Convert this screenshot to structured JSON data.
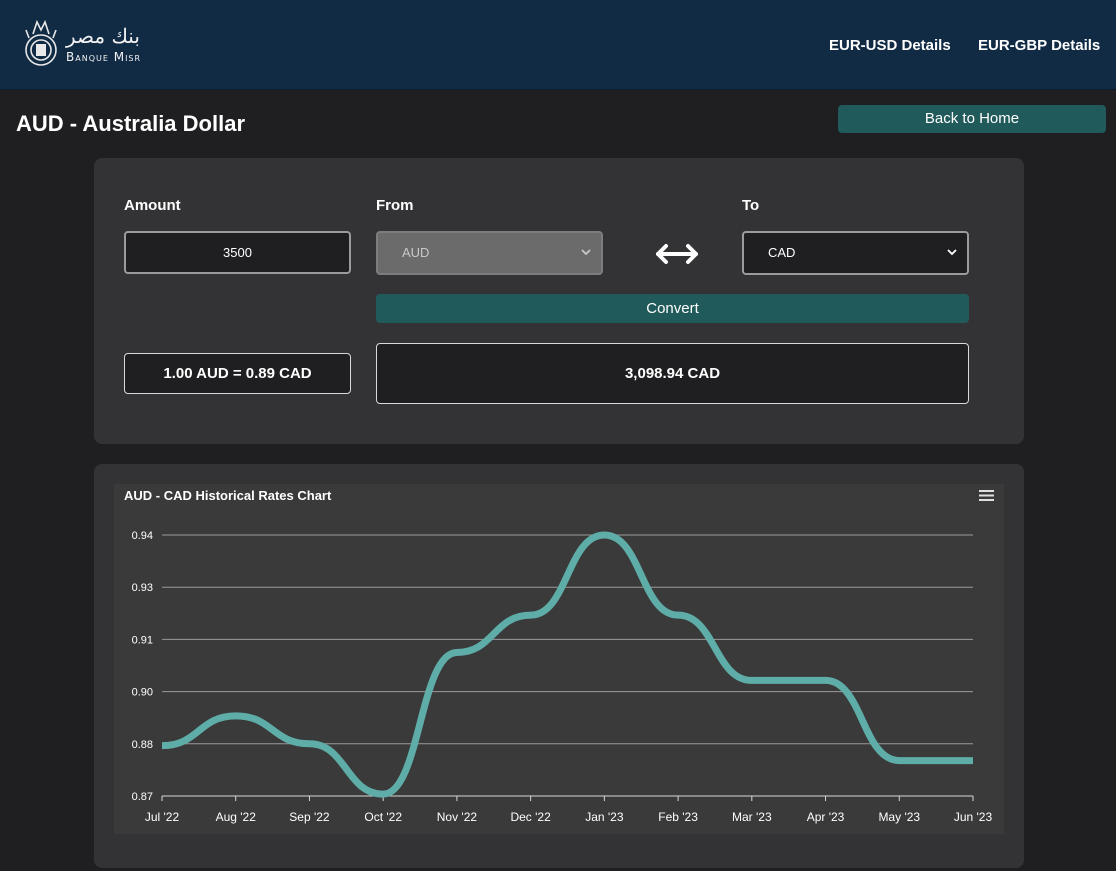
{
  "header": {
    "logo": {
      "arabic": "بنك مصر",
      "latin": "Banque Misr",
      "icon": "bank-emblem-icon"
    },
    "nav": [
      {
        "label": "EUR-USD Details"
      },
      {
        "label": "EUR-GBP Details"
      }
    ]
  },
  "page": {
    "title": "AUD - Australia Dollar",
    "back_label": "Back to Home"
  },
  "converter": {
    "amount_label": "Amount",
    "amount_value": "3500",
    "from_label": "From",
    "from_value": "AUD",
    "to_label": "To",
    "to_value": "CAD",
    "swap_icon": "swap-arrows-icon",
    "convert_label": "Convert",
    "rate_text": "1.00 AUD = 0.89 CAD",
    "result_text": "3,098.94 CAD"
  },
  "colors": {
    "header_bg": "#112b45",
    "accent": "#215a5b",
    "line": "#5fada8"
  },
  "chart_data": {
    "type": "line",
    "title": "AUD - CAD Historical Rates Chart",
    "categories": [
      "Jul '22",
      "Aug '22",
      "Sep '22",
      "Oct '22",
      "Nov '22",
      "Dec '22",
      "Jan '23",
      "Feb '23",
      "Mar '23",
      "Apr '23",
      "May '23",
      "Jun '23"
    ],
    "y_tick_labels": [
      "0.87",
      "0.88",
      "0.90",
      "0.91",
      "0.93",
      "0.94"
    ],
    "ylim": [
      0.87,
      0.94
    ],
    "series": [
      {
        "values": [
          0.8835,
          0.8915,
          0.884,
          0.8705,
          0.9085,
          0.9185,
          0.94,
          0.9185,
          0.901,
          0.901,
          0.8795,
          0.8795
        ]
      }
    ],
    "grid": true,
    "legend": "none"
  }
}
